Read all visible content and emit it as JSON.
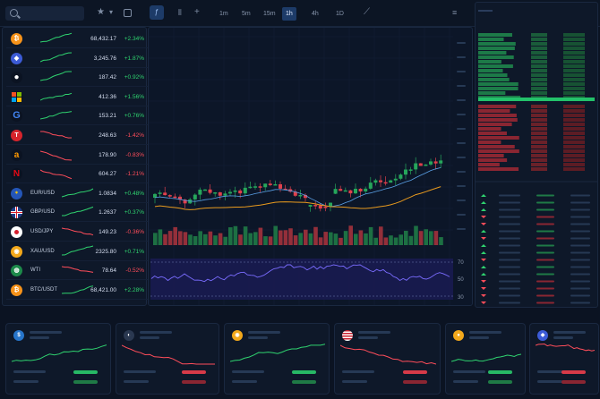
{
  "toolbar": {
    "timeframes": [
      "1m",
      "5m",
      "15m",
      "1h",
      "4h",
      "1D"
    ],
    "active_timeframe": "1h"
  },
  "watchlist": [
    {
      "symbol": "",
      "logo": "bitcoin",
      "logo_color": "#f7931a",
      "glyph": "₿",
      "price": "68,432.17",
      "change": "+2.34%",
      "trend": "up"
    },
    {
      "symbol": "",
      "logo": "ethereum",
      "logo_color": "#3c5bd6",
      "glyph": "◆",
      "price": "3,245.76",
      "change": "+1.87%",
      "trend": "up"
    },
    {
      "symbol": "",
      "logo": "apple",
      "logo_color": "#0b1322",
      "glyph": "●",
      "price": "187.42",
      "change": "+0.92%",
      "trend": "up"
    },
    {
      "symbol": "",
      "logo": "microsoft",
      "logo_color": "#0b1322",
      "glyph": "",
      "price": "412.36",
      "change": "+1.56%",
      "trend": "up"
    },
    {
      "symbol": "",
      "logo": "google",
      "logo_color": "#0b1322",
      "glyph": "G",
      "price": "153.21",
      "change": "+0.76%",
      "trend": "up"
    },
    {
      "symbol": "",
      "logo": "tesla",
      "logo_color": "#d6242c",
      "glyph": "T",
      "price": "248.63",
      "change": "-1.42%",
      "trend": "down"
    },
    {
      "symbol": "",
      "logo": "amazon",
      "logo_color": "#0b1322",
      "glyph": "a",
      "price": "178.90",
      "change": "-0.83%",
      "trend": "down"
    },
    {
      "symbol": "",
      "logo": "netflix",
      "logo_color": "#0b1322",
      "glyph": "N",
      "price": "604.27",
      "change": "-1.21%",
      "trend": "down"
    },
    {
      "symbol": "EUR/USD",
      "logo": "eu-flag",
      "logo_color": "#2456b8",
      "glyph": "",
      "price": "1.0834",
      "change": "+0.48%",
      "trend": "up"
    },
    {
      "symbol": "GBP/USD",
      "logo": "uk-flag",
      "logo_color": "#1f3d8a",
      "glyph": "",
      "price": "1.2637",
      "change": "+0.37%",
      "trend": "up"
    },
    {
      "symbol": "USD/JPY",
      "logo": "japan-flag",
      "logo_color": "#ffffff",
      "glyph": "",
      "price": "149.23",
      "change": "-0.36%",
      "trend": "down"
    },
    {
      "symbol": "XAU/USD",
      "logo": "gold",
      "logo_color": "#f3a81b",
      "glyph": "◉",
      "price": "2325.80",
      "change": "+0.71%",
      "trend": "up"
    },
    {
      "symbol": "WTI",
      "logo": "oil-drop",
      "logo_color": "#1d8a4a",
      "glyph": "◍",
      "price": "78.64",
      "change": "-0.52%",
      "trend": "down"
    },
    {
      "symbol": "BTC/USDT",
      "logo": "bitcoin",
      "logo_color": "#f7931a",
      "glyph": "₿",
      "price": "68,421.00",
      "change": "+2.28%",
      "trend": "up"
    }
  ],
  "rsi": {
    "levels": [
      "70",
      "50",
      "30"
    ]
  },
  "bottom_cards": [
    {
      "logo": "usdc",
      "logo_color": "#2775ca",
      "glyph": "$",
      "trend": "up"
    },
    {
      "logo": "drop",
      "logo_color": "#2a3850",
      "glyph": "◐",
      "trend": "down"
    },
    {
      "logo": "gold",
      "logo_color": "#f3a81b",
      "glyph": "◉",
      "trend": "up"
    },
    {
      "logo": "us-flag",
      "logo_color": "#c8202f",
      "glyph": "",
      "trend": "down"
    },
    {
      "logo": "coin",
      "logo_color": "#f3a81b",
      "glyph": "●",
      "trend": "up"
    },
    {
      "logo": "ethereum",
      "logo_color": "#3c5bd6",
      "glyph": "◆",
      "trend": "down"
    }
  ],
  "colors": {
    "up": "#2fd36f",
    "down": "#ff4d5a",
    "accent": "#1d3b68",
    "ma_fast": "#5aa0e6",
    "ma_slow": "#e89a1e"
  }
}
